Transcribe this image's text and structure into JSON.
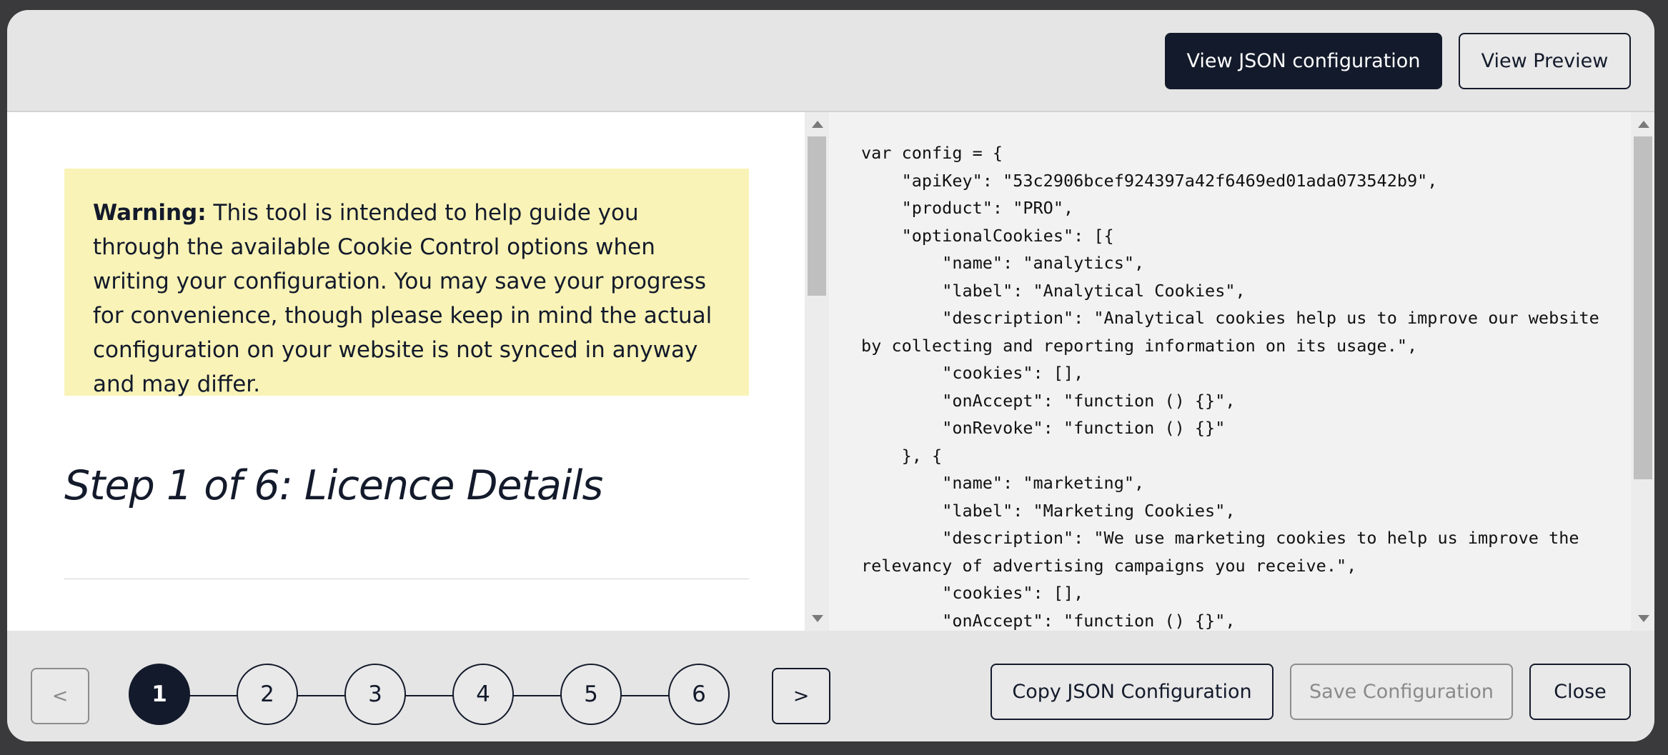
{
  "header": {
    "view_json_label": "View JSON configuration",
    "view_preview_label": "View Preview"
  },
  "warning": {
    "bold": "Warning:",
    "text": " This tool is intended to help guide you through the available Cookie Control options when writing your configuration. You may save your progress for convenience, though please keep in mind the actual configuration on your website is not synced in anyway and may differ."
  },
  "step_title": "Step 1 of 6: Licence Details",
  "code": "var config = {\n    \"apiKey\": \"53c2906bcef924397a42f6469ed01ada073542b9\",\n    \"product\": \"PRO\",\n    \"optionalCookies\": [{\n        \"name\": \"analytics\",\n        \"label\": \"Analytical Cookies\",\n        \"description\": \"Analytical cookies help us to improve our website by collecting and reporting information on its usage.\",\n        \"cookies\": [],\n        \"onAccept\": \"function () {}\",\n        \"onRevoke\": \"function () {}\"\n    }, {\n        \"name\": \"marketing\",\n        \"label\": \"Marketing Cookies\",\n        \"description\": \"We use marketing cookies to help us improve the relevancy of advertising campaigns you receive.\",\n        \"cookies\": [],\n        \"onAccept\": \"function () {}\",\n        \"onRevoke\": \"function () {}\"\n    }]\n};",
  "footer": {
    "prev_label": "<",
    "next_label": ">",
    "steps": [
      "1",
      "2",
      "3",
      "4",
      "5",
      "6"
    ],
    "active_step": "1",
    "copy_label": "Copy JSON Configuration",
    "save_label": "Save Configuration",
    "close_label": "Close"
  },
  "colors": {
    "primary": "#131a2b",
    "warning_bg": "#f9f3b7",
    "modal_bg": "#e5e5e5"
  }
}
